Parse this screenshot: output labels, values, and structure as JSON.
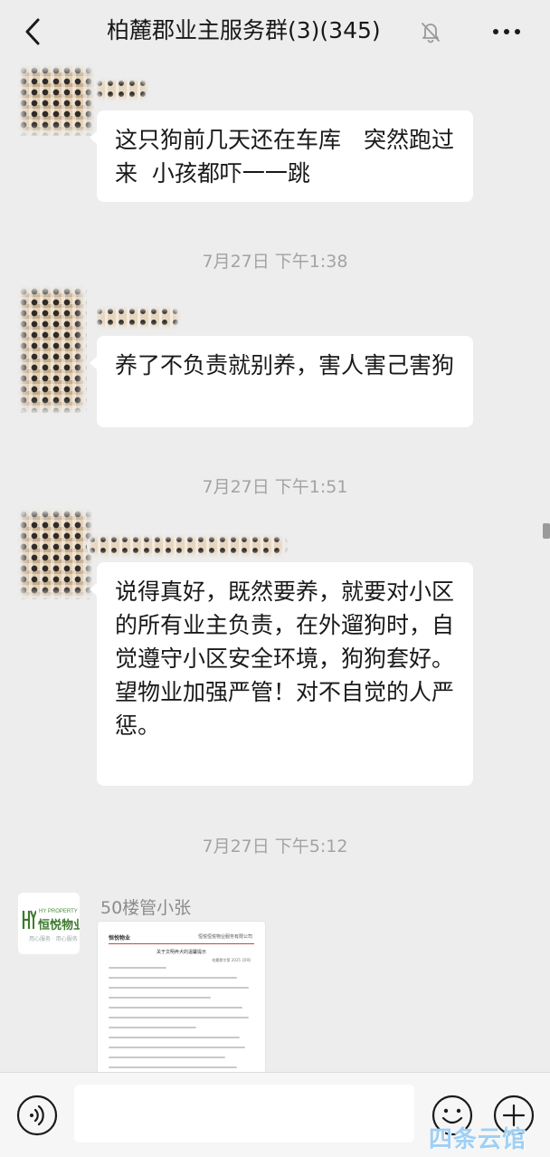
{
  "header": {
    "title": "柏麓郡业主服务群(3)(345)",
    "back_icon": "chevron-left-icon",
    "mute_icon": "bell-off-icon",
    "more_icon": "more-horizontal-icon"
  },
  "messages": [
    {
      "type": "text",
      "text": "这只狗前几天还在车库　突然跑过来  小孩都吓一一跳"
    },
    {
      "type": "time",
      "text": "7月27日 下午1:38"
    },
    {
      "type": "text",
      "text": "养了不负责就别养，害人害己害狗"
    },
    {
      "type": "time",
      "text": "7月27日 下午1:51"
    },
    {
      "type": "text",
      "text": "说得真好，既然要养，就要对小区的所有业主负责，在外遛狗时，自觉遵守小区安全环境，狗狗套好。\n望物业加强严管！对不自觉的人严惩。"
    },
    {
      "type": "time",
      "text": "7月27日 下午5:12"
    },
    {
      "type": "image",
      "sender": "50楼管小张",
      "avatar_logo": {
        "en": "HY PROPERTY",
        "cn": "恒悦物业",
        "sub": "用心服务 · 用心服务"
      },
      "document": {
        "company_logo": "恒悦物业",
        "company_name": "恒悦恒悦物业服务有限公司",
        "title": "关于文明养犬的温馨提示",
        "number": "柏麓郡字第 2025【09】"
      }
    }
  ],
  "input_bar": {
    "voice_icon": "voice-icon",
    "emoji_icon": "emoji-icon",
    "plus_icon": "plus-circle-icon"
  },
  "watermark": "四条云馆",
  "colors": {
    "background": "#ededed",
    "bubble": "#ffffff",
    "timestamp": "#a3a3a3",
    "brand_green": "#3d7a2e"
  }
}
